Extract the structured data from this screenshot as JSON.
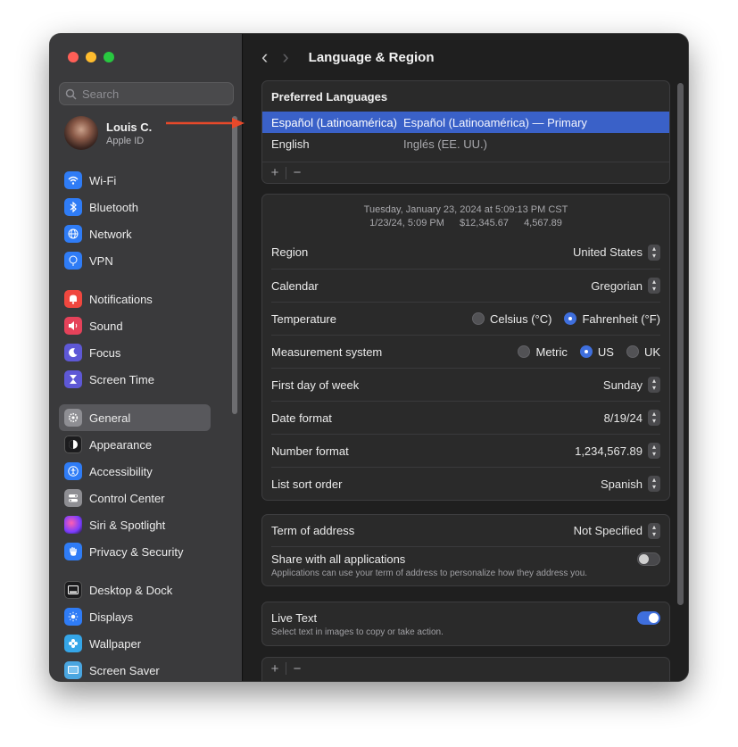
{
  "window": {
    "title": "Language & Region"
  },
  "sidebar": {
    "search_placeholder": "Search",
    "account": {
      "name": "Louis C.",
      "subtitle": "Apple ID"
    },
    "groups": [
      [
        {
          "label": "Wi-Fi",
          "icon": "wifi-icon",
          "color": "#2f7cf6"
        },
        {
          "label": "Bluetooth",
          "icon": "bluetooth-icon",
          "color": "#2f7cf6"
        },
        {
          "label": "Network",
          "icon": "globe-icon",
          "color": "#2f7cf6"
        },
        {
          "label": "VPN",
          "icon": "vpn-icon",
          "color": "#2f7cf6"
        }
      ],
      [
        {
          "label": "Notifications",
          "icon": "bell-icon",
          "color": "#f0473f"
        },
        {
          "label": "Sound",
          "icon": "speaker-icon",
          "color": "#e5425a"
        },
        {
          "label": "Focus",
          "icon": "moon-icon",
          "color": "#5e58d6"
        },
        {
          "label": "Screen Time",
          "icon": "hourglass-icon",
          "color": "#5e58d6"
        }
      ],
      [
        {
          "label": "General",
          "icon": "gear-icon",
          "color": "#8e8e93",
          "selected": true
        },
        {
          "label": "Appearance",
          "icon": "appearance-icon",
          "color": "#1c1c1e"
        },
        {
          "label": "Accessibility",
          "icon": "accessibility-icon",
          "color": "#2f7cf6"
        },
        {
          "label": "Control Center",
          "icon": "toggles-icon",
          "color": "#8e8e93"
        },
        {
          "label": "Siri & Spotlight",
          "icon": "siri-icon",
          "color": "#c94fd8"
        },
        {
          "label": "Privacy & Security",
          "icon": "hand-icon",
          "color": "#2f7cf6"
        }
      ],
      [
        {
          "label": "Desktop & Dock",
          "icon": "dock-icon",
          "color": "#1c1c1e"
        },
        {
          "label": "Displays",
          "icon": "sun-icon",
          "color": "#2f7cf6"
        },
        {
          "label": "Wallpaper",
          "icon": "flower-icon",
          "color": "#35a6e8"
        },
        {
          "label": "Screen Saver",
          "icon": "screensaver-icon",
          "color": "#4aa6e0"
        }
      ]
    ]
  },
  "preferred_languages": {
    "header": "Preferred Languages",
    "items": [
      {
        "name": "Español (Latinoamérica)",
        "desc": "Español (Latinoamérica) — Primary",
        "selected": true
      },
      {
        "name": "English",
        "desc": "Inglés (EE. UU.)",
        "selected": false
      }
    ],
    "add": "+",
    "remove": "−"
  },
  "preview": {
    "line1": "Tuesday, January 23, 2024 at 5:09:13 PM CST",
    "short_date": "1/23/24, 5:09 PM",
    "currency": "$12,345.67",
    "number": "4,567.89"
  },
  "settings": {
    "region": {
      "label": "Region",
      "value": "United States"
    },
    "calendar": {
      "label": "Calendar",
      "value": "Gregorian"
    },
    "temperature": {
      "label": "Temperature",
      "opt1": "Celsius (°C)",
      "opt2": "Fahrenheit (°F)",
      "selected": "Fahrenheit (°F)"
    },
    "measurement": {
      "label": "Measurement system",
      "opt1": "Metric",
      "opt2": "US",
      "opt3": "UK",
      "selected": "US"
    },
    "first_day": {
      "label": "First day of week",
      "value": "Sunday"
    },
    "date_format": {
      "label": "Date format",
      "value": "8/19/24"
    },
    "number_format": {
      "label": "Number format",
      "value": "1,234,567.89"
    },
    "list_sort": {
      "label": "List sort order",
      "value": "Spanish"
    }
  },
  "address": {
    "term_label": "Term of address",
    "term_value": "Not Specified",
    "share_label": "Share with all applications",
    "share_sub": "Applications can use your term of address to personalize how they address you.",
    "share_on": false
  },
  "live_text": {
    "label": "Live Text",
    "sub": "Select text in images to copy or take action.",
    "on": true
  },
  "bottom_bar": {
    "add": "+",
    "remove": "−"
  },
  "colors": {
    "accent": "#3f6fdd",
    "annotation_arrow": "#e8492a"
  }
}
